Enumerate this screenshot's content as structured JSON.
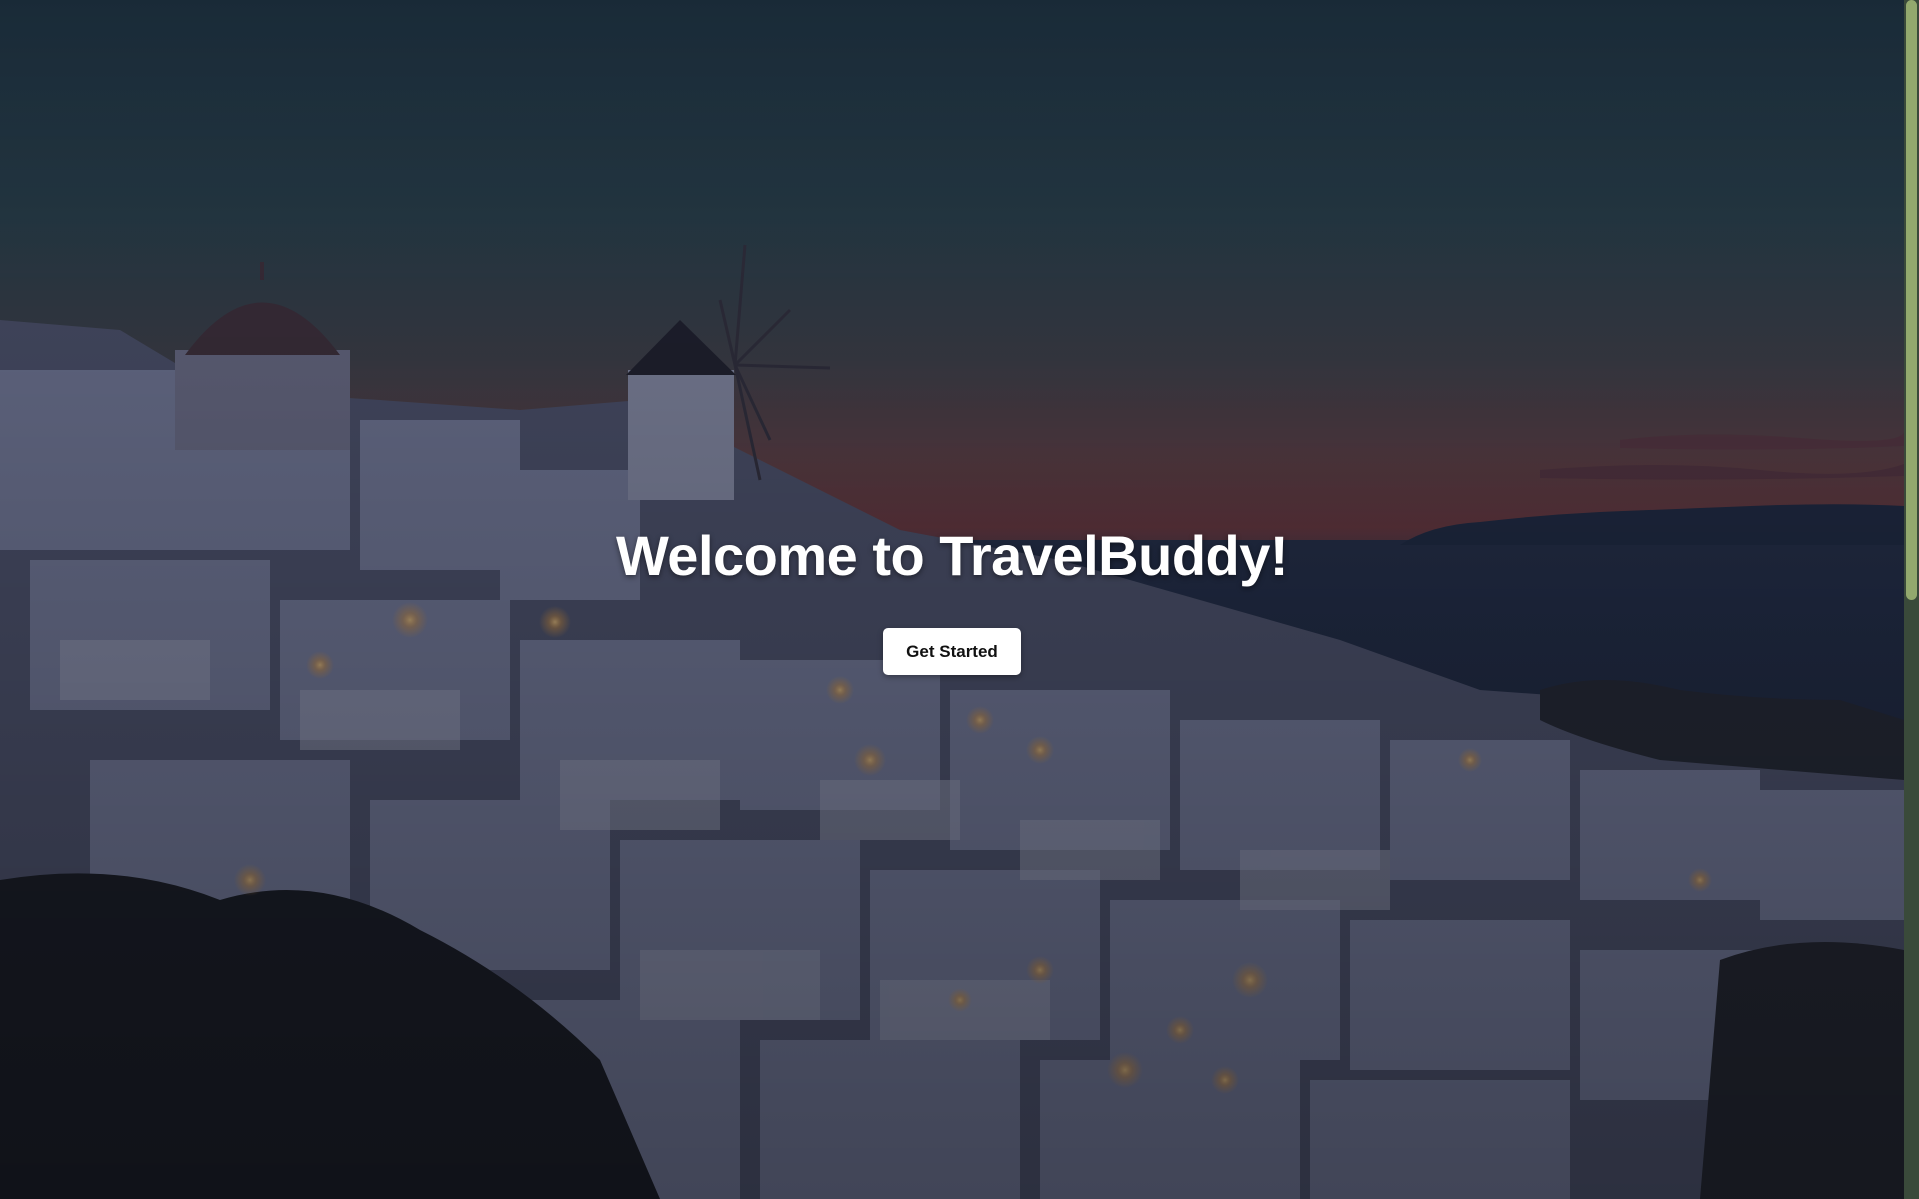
{
  "hero": {
    "title": "Welcome to TravelBuddy!",
    "cta_label": "Get Started",
    "background_icon": "santorini-night-photo"
  },
  "colors": {
    "button_bg": "#ffffff",
    "button_text": "#111111",
    "title_text": "#ffffff",
    "scrollbar_thumb": "#93a96e"
  }
}
